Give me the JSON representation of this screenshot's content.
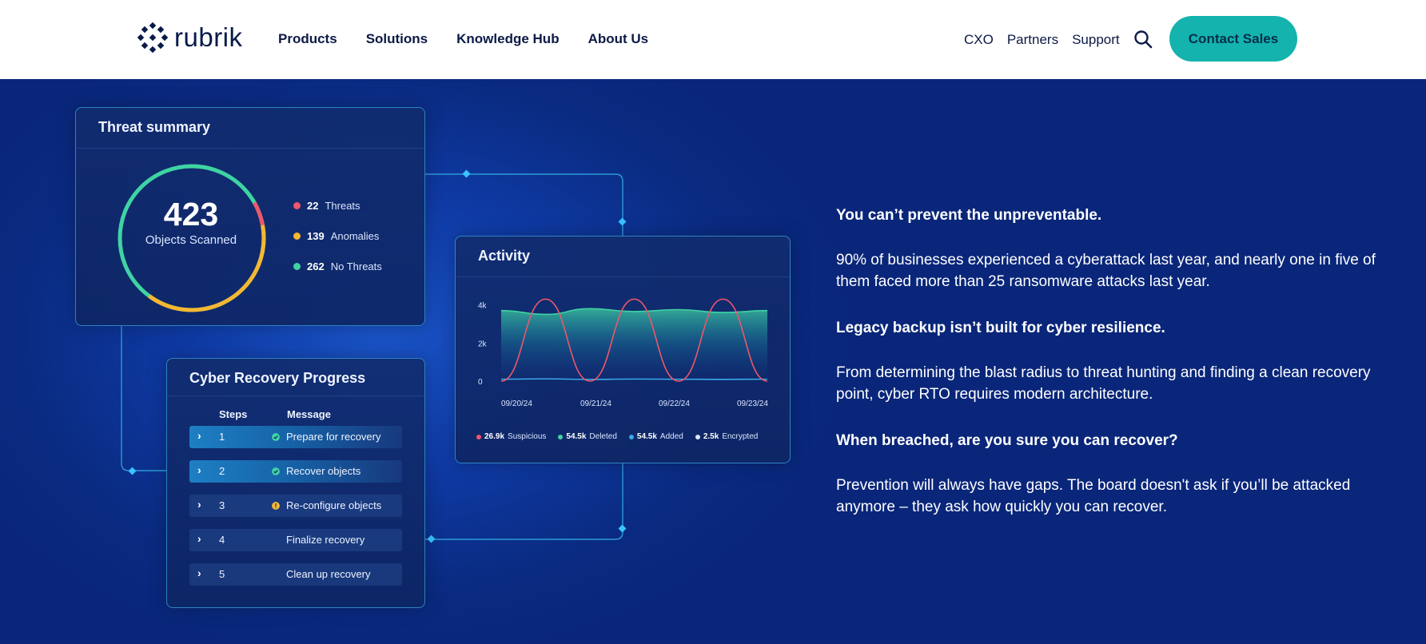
{
  "header": {
    "brand": "rubrik",
    "nav": [
      "Products",
      "Solutions",
      "Knowledge Hub",
      "About Us"
    ],
    "nav_right": [
      "CXO",
      "Partners",
      "Support"
    ],
    "cta_label": "Contact Sales",
    "colors": {
      "cta": "#14b3ad",
      "text": "#0c1a45"
    }
  },
  "threat_summary": {
    "title": "Threat summary",
    "total": "423",
    "total_label": "Objects Scanned",
    "legend": [
      {
        "count": "22",
        "label": "Threats",
        "color": "#f0566a"
      },
      {
        "count": "139",
        "label": "Anomalies",
        "color": "#f5b731"
      },
      {
        "count": "262",
        "label": "No Threats",
        "color": "#3fd3a3"
      }
    ]
  },
  "activity": {
    "title": "Activity",
    "legend": [
      {
        "count": "26.9k",
        "label": "Suspicious",
        "color": "#f0566a"
      },
      {
        "count": "54.5k",
        "label": "Deleted",
        "color": "#3fd3a3"
      },
      {
        "count": "54.5k",
        "label": "Added",
        "color": "#3aa8e8"
      },
      {
        "count": "2.5k",
        "label": "Encrypted",
        "color": "#dbe6ff"
      }
    ]
  },
  "chart_data": {
    "type": "line",
    "title": "Activity",
    "x": [
      "09/20/24",
      "09/21/24",
      "09/22/24",
      "09/23/24"
    ],
    "yticks": [
      "0",
      "2k",
      "4k"
    ],
    "ylim": [
      0,
      4400
    ],
    "series": [
      {
        "name": "Suspicious",
        "color": "#f0566a",
        "values": [
          0,
          4300,
          0,
          4300,
          0,
          4300,
          0
        ]
      },
      {
        "name": "Deleted",
        "color": "#3fd3a3",
        "values": [
          3700,
          3500,
          3800,
          3650,
          3750,
          3600,
          3700
        ]
      },
      {
        "name": "Added",
        "color": "#3aa8e8",
        "values": [
          100,
          120,
          90,
          110,
          100,
          90,
          100
        ]
      }
    ]
  },
  "recovery": {
    "title": "Cyber Recovery Progress",
    "col_steps": "Steps",
    "col_message": "Message",
    "rows": [
      {
        "num": "1",
        "message": "Prepare for recovery",
        "status": "done"
      },
      {
        "num": "2",
        "message": "Recover objects",
        "status": "done"
      },
      {
        "num": "3",
        "message": "Re-configure objects",
        "status": "warning"
      },
      {
        "num": "4",
        "message": "Finalize recovery",
        "status": "none"
      },
      {
        "num": "5",
        "message": "Clean up recovery",
        "status": "none"
      }
    ]
  },
  "copy": {
    "h1": "You can’t prevent the unpreventable.",
    "p1": "90% of businesses experienced a cyberattack last year, and nearly one in five of them faced more than 25 ransomware attacks last year.",
    "h2": "Legacy backup isn’t built for cyber resilience.",
    "p2": "From determining the blast radius to threat hunting and finding a clean recovery point, cyber RTO requires modern architecture.",
    "h3": "When breached, are you sure you can recover?",
    "p3": "Prevention will always have gaps. The board doesn't ask if you’ll be attacked anymore – they ask how quickly you can recover."
  }
}
